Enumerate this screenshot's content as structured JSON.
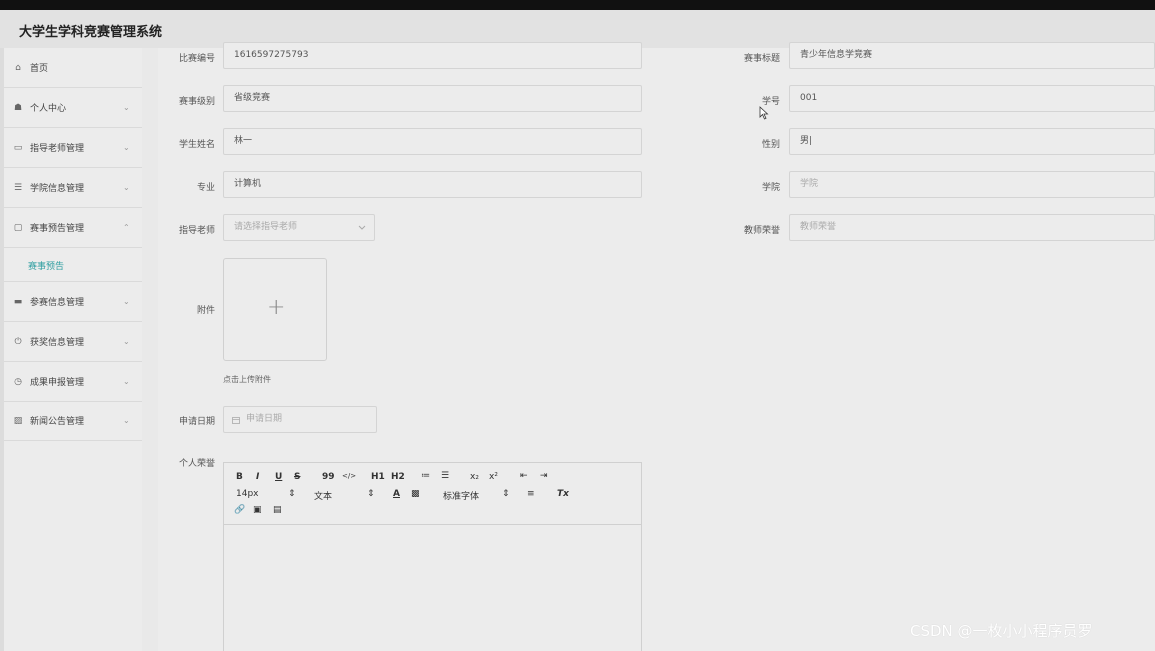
{
  "app": {
    "title": "大学生学科竞赛管理系统"
  },
  "sidebar": {
    "items": [
      {
        "label": "首页",
        "icon": "home-icon",
        "glyph": "⌂",
        "has_chevron": false
      },
      {
        "label": "个人中心",
        "icon": "user-icon",
        "glyph": "☗",
        "chevron": "⌄"
      },
      {
        "label": "指导老师管理",
        "icon": "id-card-icon",
        "glyph": "▭",
        "chevron": "⌄"
      },
      {
        "label": "学院信息管理",
        "icon": "list-icon",
        "glyph": "☰",
        "chevron": "⌄"
      },
      {
        "label": "赛事预告管理",
        "icon": "message-icon",
        "glyph": "▢",
        "chevron": "⌃"
      },
      {
        "label": "参赛信息管理",
        "icon": "monitor-icon",
        "glyph": "▬",
        "chevron": "⌄"
      },
      {
        "label": "获奖信息管理",
        "icon": "power-icon",
        "glyph": "⏻",
        "chevron": "⌄"
      },
      {
        "label": "成果申报管理",
        "icon": "clock-icon",
        "glyph": "◷",
        "chevron": "⌄"
      },
      {
        "label": "新闻公告管理",
        "icon": "chart-icon",
        "glyph": "▨",
        "chevron": "⌄"
      }
    ],
    "sub_item": "赛事预告",
    "accent_color": "#2e9ea0"
  },
  "form": {
    "competition_no": {
      "label": "比赛编号",
      "value": "1616597275793"
    },
    "event_title": {
      "label": "赛事标题",
      "value": "青少年信息学竞赛"
    },
    "event_level": {
      "label": "赛事级别",
      "value": "省级竞赛"
    },
    "student_no": {
      "label": "学号",
      "value": "001"
    },
    "student_name": {
      "label": "学生姓名",
      "value": "林一"
    },
    "gender": {
      "label": "性别",
      "value": "男|"
    },
    "major": {
      "label": "专业",
      "value": "计算机"
    },
    "college": {
      "label": "学院",
      "placeholder": "学院"
    },
    "advisor": {
      "label": "指导老师",
      "placeholder": "请选择指导老师"
    },
    "teacher_honor": {
      "label": "教师荣誉",
      "placeholder": "教师荣誉"
    },
    "attachment": {
      "label": "附件",
      "tip": "点击上传附件",
      "plus": "+"
    },
    "apply_date": {
      "label": "申请日期",
      "placeholder": "申请日期"
    },
    "personal_honor": {
      "label": "个人荣誉"
    }
  },
  "editor": {
    "row1": [
      "B",
      "I",
      "U",
      "S",
      "99",
      "</>",
      "H1",
      "H2",
      "≔",
      "☰",
      "x₂",
      "x²",
      "⇤",
      "⇥"
    ],
    "font_size": "14px",
    "text_format": "文本",
    "font_family": "标准字体",
    "row2_icons": [
      "A",
      "▩",
      "≡",
      "Tx"
    ],
    "row3": [
      "🔗",
      "▣",
      "▤"
    ]
  },
  "watermark": "CSDN @一枚小小程序员罗"
}
